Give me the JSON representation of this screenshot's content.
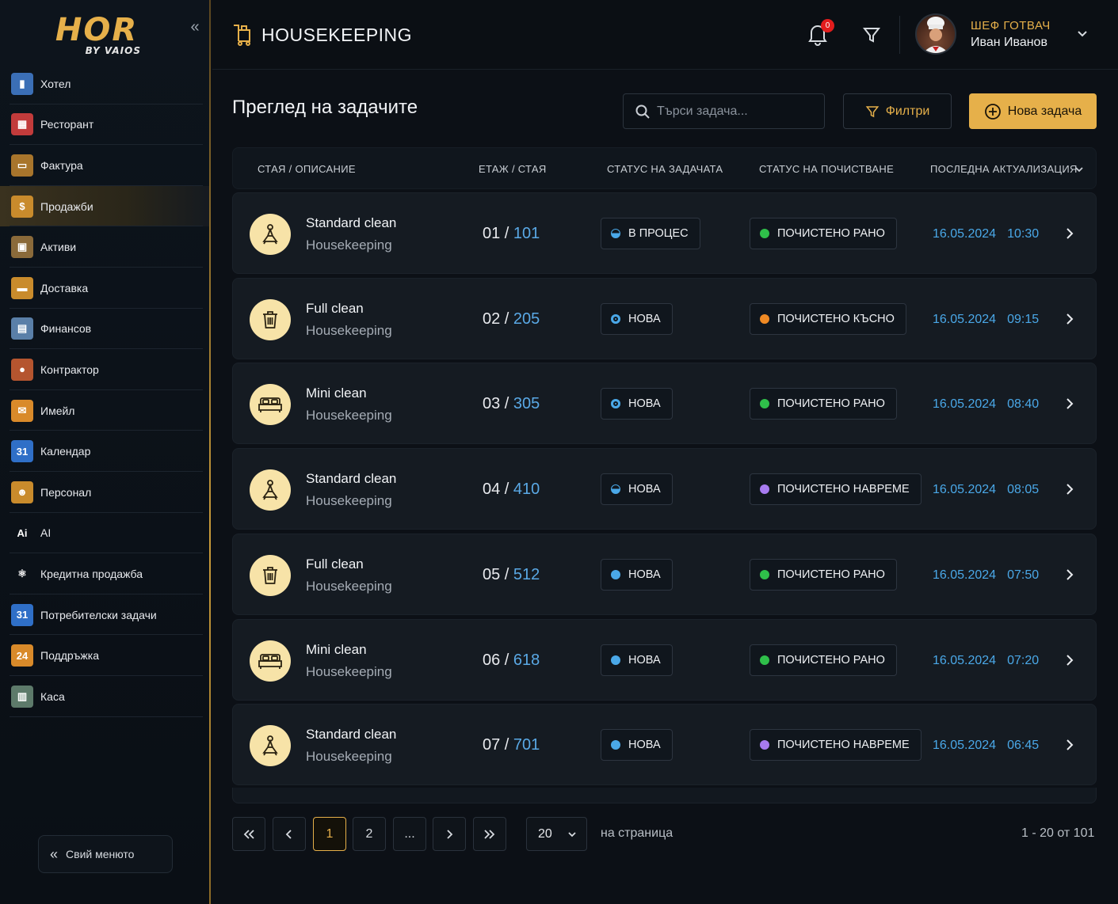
{
  "brand": {
    "logo_main": "HOR",
    "logo_sub": "BY VAIOS",
    "accent": "#e6b04a"
  },
  "sidebar": {
    "items": [
      {
        "label": "Хотел",
        "icon": "hotel-icon",
        "color": "#3b6fb6",
        "glyph": "▮"
      },
      {
        "label": "Ресторант",
        "icon": "restaurant-icon",
        "color": "#c23b3b",
        "glyph": "▦"
      },
      {
        "label": "Фактура",
        "icon": "invoice-icon",
        "color": "#a8752c",
        "glyph": "▭"
      },
      {
        "label": "Продажби",
        "icon": "sales-bag-icon",
        "color": "#c98b2c",
        "glyph": "$",
        "active": true
      },
      {
        "label": "Активи",
        "icon": "assets-box-icon",
        "color": "#8a6a3a",
        "glyph": "▣"
      },
      {
        "label": "Доставка",
        "icon": "delivery-truck-icon",
        "color": "#c98b2c",
        "glyph": "▬"
      },
      {
        "label": "Финансов",
        "icon": "finance-printer-icon",
        "color": "#5a7fa8",
        "glyph": "▤"
      },
      {
        "label": "Контрактор",
        "icon": "contractor-icon",
        "color": "#b5552f",
        "glyph": "●"
      },
      {
        "label": "Имейл",
        "icon": "mail-icon",
        "color": "#d98a2a",
        "glyph": "✉"
      },
      {
        "label": "Календар",
        "icon": "calendar-icon",
        "color": "#2f6fc7",
        "glyph": "31"
      },
      {
        "label": "Персонал",
        "icon": "staff-icon",
        "color": "#c98b2c",
        "glyph": "☻"
      },
      {
        "label": "AI",
        "icon": "ai-icon",
        "color": "transparent",
        "glyph": "Ai"
      },
      {
        "label": "Кредитна продажба",
        "icon": "atom-icon",
        "color": "transparent",
        "glyph": "⚛"
      },
      {
        "label": "Потребителски задачи",
        "icon": "user-tasks-calendar-icon",
        "color": "#2f6fc7",
        "glyph": "31"
      },
      {
        "label": "Поддръжка",
        "icon": "support-24-icon",
        "color": "#d98a2a",
        "glyph": "24"
      },
      {
        "label": "Каса",
        "icon": "cash-register-icon",
        "color": "#5d7a6a",
        "glyph": "▥"
      }
    ],
    "collapse_label": "Свий менюто"
  },
  "header": {
    "title": "HOUSEKEEPING",
    "notifications_count": "0",
    "user_role": "ШЕФ ГОТВАЧ",
    "user_name": "Иван Иванов"
  },
  "toolbar": {
    "page_title": "Преглед на задачите",
    "search_placeholder": "Търси задача...",
    "filters_label": "Филтри",
    "new_task_label": "Нова задача"
  },
  "table": {
    "columns": {
      "room_desc": "СТАЯ / ОПИСАНИЕ",
      "floor_room": "ЕТАЖ / СТАЯ",
      "task_status": "СТАТУС НА ЗАДАЧАТА",
      "cleaning_status": "СТАТУС НА ПОЧИСТВАНЕ",
      "last_update": "ПОСЛЕДНА АКТУАЛИЗАЦИЯ"
    },
    "rows": [
      {
        "title": "Standard clean",
        "sub": "Housekeeping",
        "icon": "cleaning-person-icon",
        "floor": "01",
        "room": "101",
        "task_status": "В ПРОЦЕС",
        "task_dot": "half",
        "clean_status": "ПОЧИСТЕНО РАНО",
        "clean_color": "#2fbf4a",
        "date": "16.05.2024",
        "time": "10:30"
      },
      {
        "title": "Full clean",
        "sub": "Housekeeping",
        "icon": "trash-bin-icon",
        "floor": "02",
        "room": "205",
        "task_status": "НОВА",
        "task_dot": "ring",
        "clean_status": "ПОЧИСТЕНО КЪСНО",
        "clean_color": "#f08a24",
        "date": "16.05.2024",
        "time": "09:15"
      },
      {
        "title": "Mini clean",
        "sub": "Housekeeping",
        "icon": "bed-icon",
        "floor": "03",
        "room": "305",
        "task_status": "НОВА",
        "task_dot": "ring",
        "clean_status": "ПОЧИСТЕНО РАНО",
        "clean_color": "#2fbf4a",
        "date": "16.05.2024",
        "time": "08:40"
      },
      {
        "title": "Standard clean",
        "sub": "Housekeeping",
        "icon": "cleaning-person-icon",
        "floor": "04",
        "room": "410",
        "task_status": "НОВА",
        "task_dot": "half",
        "clean_status": "ПОЧИСТЕНО НАВРЕМЕ",
        "clean_color": "#a77bf0",
        "date": "16.05.2024",
        "time": "08:05"
      },
      {
        "title": "Full clean",
        "sub": "Housekeeping",
        "icon": "trash-bin-icon",
        "floor": "05",
        "room": "512",
        "task_status": "НОВА",
        "task_dot": "solid",
        "clean_status": "ПОЧИСТЕНО РАНО",
        "clean_color": "#2fbf4a",
        "date": "16.05.2024",
        "time": "07:50"
      },
      {
        "title": "Mini clean",
        "sub": "Housekeeping",
        "icon": "bed-icon",
        "floor": "06",
        "room": "618",
        "task_status": "НОВА",
        "task_dot": "solid",
        "clean_status": "ПОЧИСТЕНО РАНО",
        "clean_color": "#2fbf4a",
        "date": "16.05.2024",
        "time": "07:20"
      },
      {
        "title": "Standard clean",
        "sub": "Housekeeping",
        "icon": "cleaning-person-icon",
        "floor": "07",
        "room": "701",
        "task_status": "НОВА",
        "task_dot": "solid",
        "clean_status": "ПОЧИСТЕНО НАВРЕМЕ",
        "clean_color": "#a77bf0",
        "date": "16.05.2024",
        "time": "06:45"
      }
    ]
  },
  "pagination": {
    "current_page": "1",
    "page_2": "2",
    "ellipsis": "...",
    "per_page_value": "20",
    "per_page_label": "на страница",
    "range_label": "1 - 20 от 101"
  }
}
